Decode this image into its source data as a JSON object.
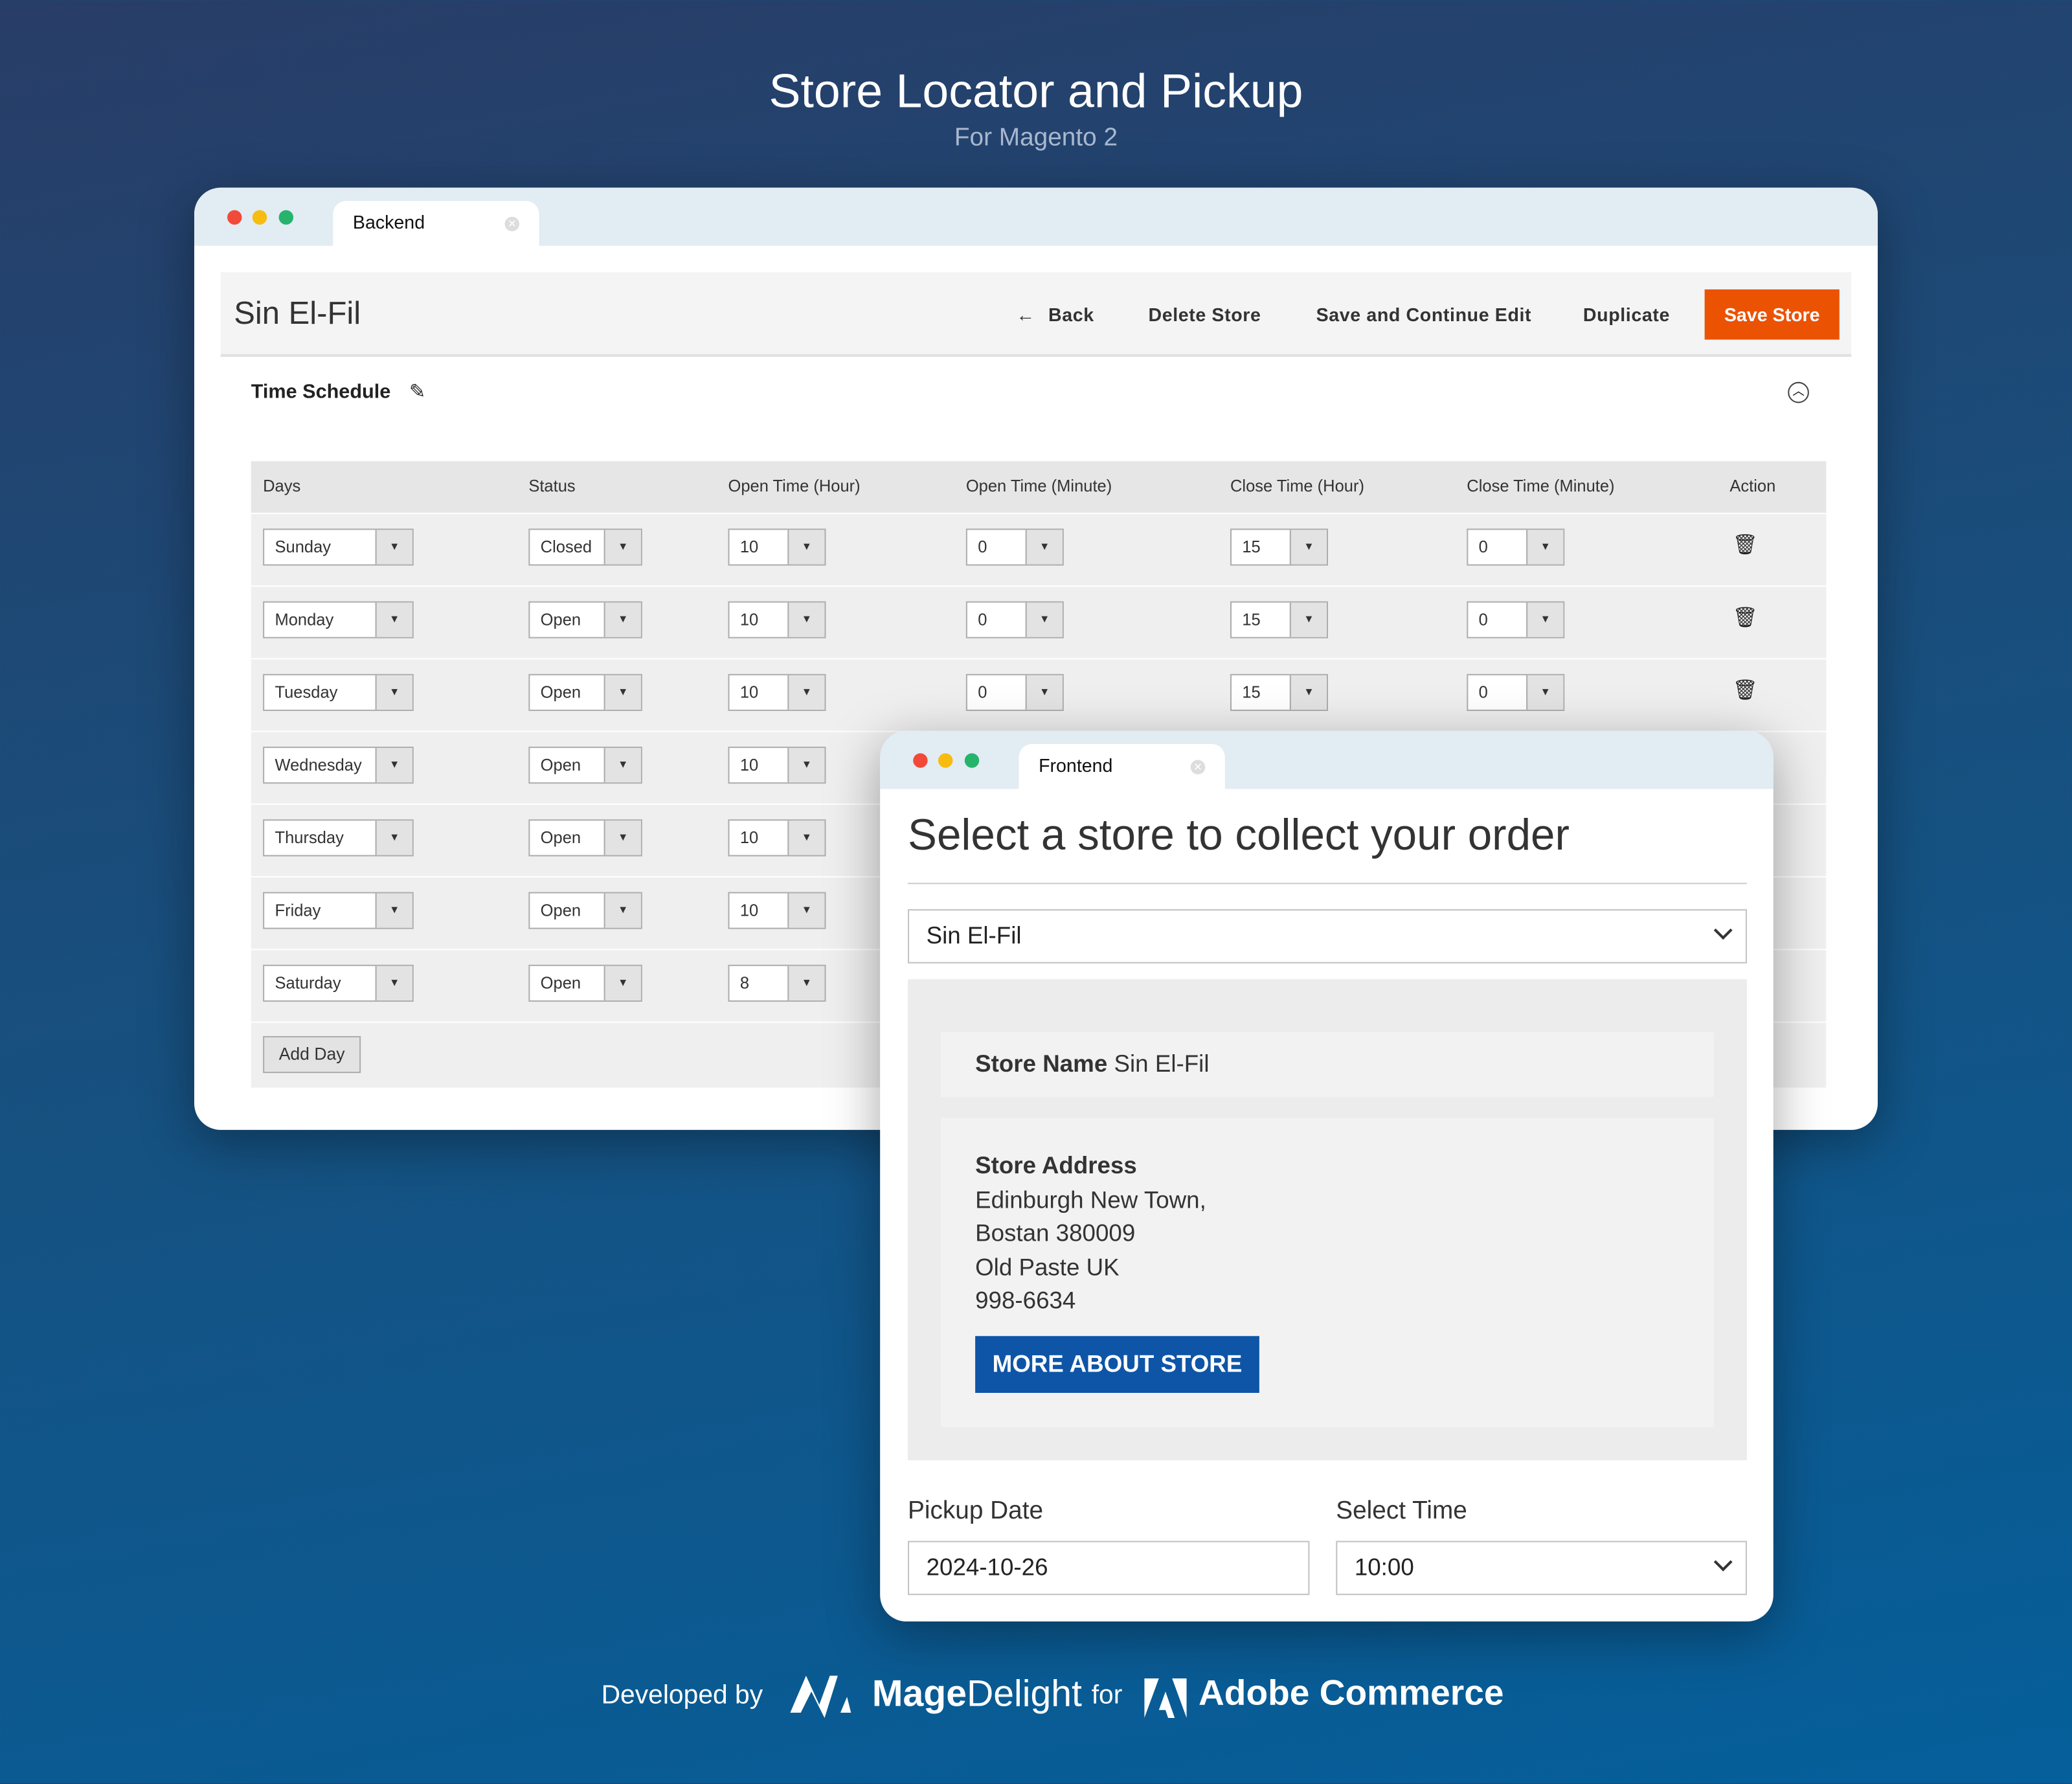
{
  "hero": {
    "title": "Store Locator and Pickup",
    "subtitle": "For Magento 2"
  },
  "backend": {
    "tab_label": "Backend",
    "page_title": "Sin El-Fil",
    "actions": {
      "back": "Back",
      "delete": "Delete Store",
      "save_continue": "Save and Continue Edit",
      "duplicate": "Duplicate",
      "save": "Save Store"
    },
    "section_title": "Time Schedule",
    "columns": [
      "Days",
      "Status",
      "Open Time (Hour)",
      "Open Time (Minute)",
      "Close Time (Hour)",
      "Close Time (Minute)",
      "Action"
    ],
    "rows": [
      {
        "day": "Sunday",
        "status": "Closed",
        "open_hour": "10",
        "open_min": "0",
        "close_hour": "15",
        "close_min": "0"
      },
      {
        "day": "Monday",
        "status": "Open",
        "open_hour": "10",
        "open_min": "0",
        "close_hour": "15",
        "close_min": "0"
      },
      {
        "day": "Tuesday",
        "status": "Open",
        "open_hour": "10",
        "open_min": "0",
        "close_hour": "15",
        "close_min": "0"
      },
      {
        "day": "Wednesday",
        "status": "Open",
        "open_hour": "10"
      },
      {
        "day": "Thursday",
        "status": "Open",
        "open_hour": "10"
      },
      {
        "day": "Friday",
        "status": "Open",
        "open_hour": "10"
      },
      {
        "day": "Saturday",
        "status": "Open",
        "open_hour": "8"
      }
    ],
    "add_day": "Add Day",
    "accent": "#eb5202"
  },
  "frontend": {
    "tab_label": "Frontend",
    "heading": "Select a store to collect your order",
    "store_select": "Sin El-Fil",
    "store_name_label": "Store Name",
    "store_name": "Sin El-Fil",
    "address_label": "Store Address",
    "address_lines": [
      "Edinburgh New Town,",
      "Bostan 380009",
      "Old Paste UK",
      "998-6634"
    ],
    "more_button": "MORE ABOUT STORE",
    "pickup_date_label": "Pickup Date",
    "pickup_date": "2024-10-26",
    "time_label": "Select Time",
    "time": "10:00",
    "accent": "#0e55a7"
  },
  "footer": {
    "developed_by": "Developed by",
    "brand_bold": "Mage",
    "brand_light": "Delight",
    "for": "for",
    "platform": "Adobe Commerce"
  }
}
